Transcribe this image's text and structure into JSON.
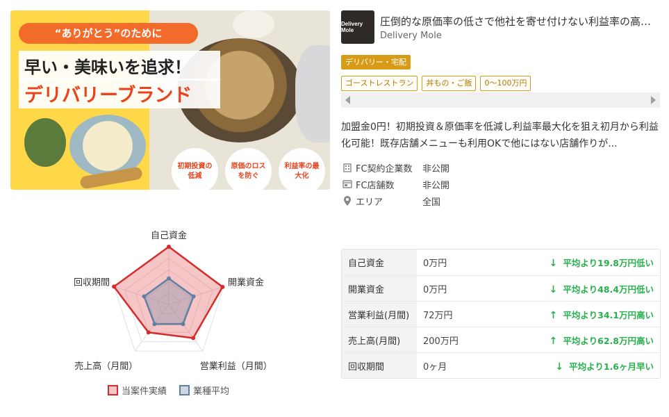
{
  "banner": {
    "ribbon": "“ありがとう”のために",
    "headline": "早い・美味いを追求！",
    "brand_text": "デリバリーブランド",
    "badges": [
      "初期投資の低減",
      "原価のロスを防ぐ",
      "利益率の最大化"
    ]
  },
  "listing": {
    "logo_text": "Delivery Mole",
    "title": "圧倒的な原価率の低さで他社を寄せ付けない利益率の高さ!...",
    "company": "Delivery Mole",
    "category": "デリバリー・宅配",
    "tags": [
      "ゴーストレストラン",
      "丼もの・ご飯",
      "0〜100万円"
    ],
    "description": "加盟金0円！初期投資＆原価率を低減し利益率最大化を狙え初月から利益化可能！既存店舗メニューも利用OKで他にはない店舗作りが..."
  },
  "meta": [
    {
      "icon": "building-icon",
      "label": "FC契約企業数",
      "value": "非公開"
    },
    {
      "icon": "store-icon",
      "label": "FC店舗数",
      "value": "非公開"
    },
    {
      "icon": "map-pin-icon",
      "label": "エリア",
      "value": "全国"
    }
  ],
  "radar": {
    "axes": [
      "自己資金",
      "開業資金",
      "営業利益（月間）",
      "売上高（月間）",
      "回収期間"
    ],
    "series": [
      {
        "name": "当案件実績",
        "color": "#d52b2b",
        "fill": "rgba(230,90,90,0.35)",
        "values": [
          1.0,
          0.98,
          0.72,
          0.6,
          1.0
        ]
      },
      {
        "name": "業種平均",
        "color": "#5f7fa3",
        "fill": "rgba(120,140,170,0.35)",
        "values": [
          0.45,
          0.45,
          0.42,
          0.42,
          0.45
        ]
      }
    ]
  },
  "comparison": [
    {
      "label": "自己資金",
      "value": "0万円",
      "direction": "down",
      "diff": "平均より19.8万円低い"
    },
    {
      "label": "開業資金",
      "value": "0万円",
      "direction": "down",
      "diff": "平均より48.4万円低い"
    },
    {
      "label": "営業利益(月間)",
      "value": "72万円",
      "direction": "up",
      "diff": "平均より34.1万円高い"
    },
    {
      "label": "売上高(月間)",
      "value": "200万円",
      "direction": "up",
      "diff": "平均より62.8万円高い"
    },
    {
      "label": "回収期間",
      "value": "0ヶ月",
      "direction": "down",
      "diff": "平均より1.6ヶ月早い"
    }
  ],
  "colors": {
    "accent_orange": "#f26b2b",
    "brand_red": "#e8431c",
    "category_gold": "#d89b17",
    "positive_green": "#27b04b"
  }
}
